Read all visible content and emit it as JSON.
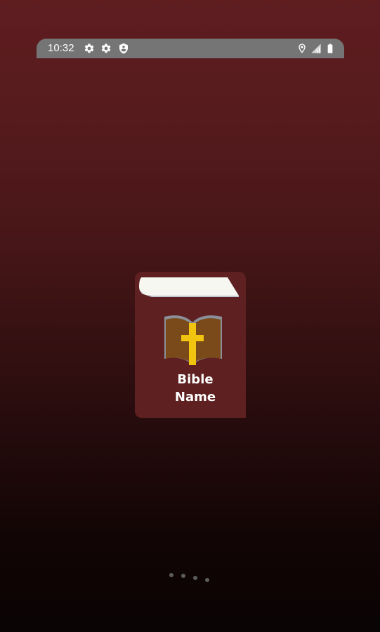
{
  "status_bar": {
    "time": "10:32",
    "left_icons": [
      "settings-icon",
      "settings-icon",
      "shield-icon"
    ],
    "right_icons": [
      "location-icon",
      "signal-icon",
      "battery-icon"
    ]
  },
  "splash": {
    "logo_line_1": "Bible",
    "logo_line_2": "Name"
  },
  "colors": {
    "background_top": "#5f1d20",
    "background_bottom": "#0a0404",
    "status_bar": "#757575",
    "book_cover": "#5e2020",
    "book_pages": "#ffffff",
    "open_book": "#7b4a1a",
    "cross": "#f1c40f",
    "loading_dot": "#5c5c5c"
  }
}
